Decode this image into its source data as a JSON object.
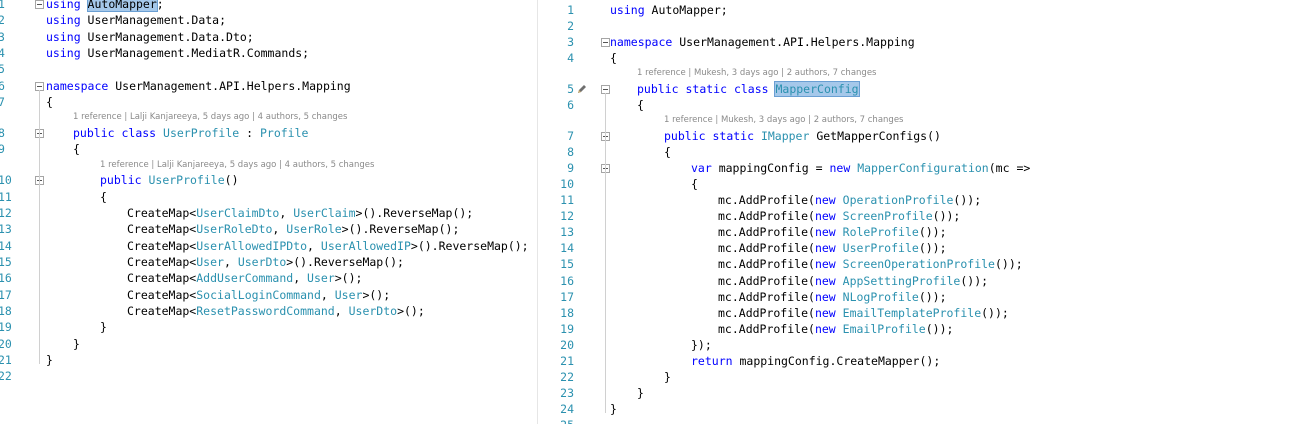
{
  "left": {
    "lines": [
      {
        "n": "1",
        "tokens": [
          {
            "t": "using ",
            "c": "kw"
          },
          {
            "t": "AutoMapper",
            "c": "hl"
          },
          {
            "t": ";",
            "c": ""
          }
        ],
        "indent": 0
      },
      {
        "n": "2",
        "tokens": [
          {
            "t": "using ",
            "c": "kw"
          },
          {
            "t": "UserManagement.Data;",
            "c": ""
          }
        ],
        "indent": 0
      },
      {
        "n": "3",
        "tokens": [
          {
            "t": "using ",
            "c": "kw"
          },
          {
            "t": "UserManagement.Data.Dto;",
            "c": ""
          }
        ],
        "indent": 0
      },
      {
        "n": "4",
        "tokens": [
          {
            "t": "using ",
            "c": "kw"
          },
          {
            "t": "UserManagement.MediatR.Commands;",
            "c": ""
          }
        ],
        "indent": 0
      },
      {
        "n": "5",
        "tokens": [],
        "indent": 0
      },
      {
        "n": "6",
        "tokens": [
          {
            "t": "namespace ",
            "c": "kw"
          },
          {
            "t": "UserManagement.API.Helpers.Mapping",
            "c": ""
          }
        ],
        "indent": 0
      },
      {
        "n": "7",
        "tokens": [
          {
            "t": "{",
            "c": ""
          }
        ],
        "indent": 0
      },
      {
        "n": "8",
        "tokens": [
          {
            "t": "public ",
            "c": "kw"
          },
          {
            "t": "class ",
            "c": "kw"
          },
          {
            "t": "UserProfile",
            "c": "ty"
          },
          {
            "t": " : ",
            "c": ""
          },
          {
            "t": "Profile",
            "c": "ty"
          }
        ],
        "indent": 1,
        "lens": "1 reference | Lalji Kanjareeya, 5 days ago | 4 authors, 5 changes"
      },
      {
        "n": "9",
        "tokens": [
          {
            "t": "{",
            "c": ""
          }
        ],
        "indent": 1
      },
      {
        "n": "10",
        "tokens": [
          {
            "t": "public ",
            "c": "kw"
          },
          {
            "t": "UserProfile",
            "c": "ty"
          },
          {
            "t": "()",
            "c": ""
          }
        ],
        "indent": 2,
        "lens": "1 reference | Lalji Kanjareeya, 5 days ago | 4 authors, 5 changes"
      },
      {
        "n": "11",
        "tokens": [
          {
            "t": "{",
            "c": ""
          }
        ],
        "indent": 2
      },
      {
        "n": "12",
        "tokens": [
          {
            "t": "CreateMap<",
            "c": ""
          },
          {
            "t": "UserClaimDto",
            "c": "ty"
          },
          {
            "t": ", ",
            "c": ""
          },
          {
            "t": "UserClaim",
            "c": "ty"
          },
          {
            "t": ">().ReverseMap();",
            "c": ""
          }
        ],
        "indent": 3
      },
      {
        "n": "13",
        "tokens": [
          {
            "t": "CreateMap<",
            "c": ""
          },
          {
            "t": "UserRoleDto",
            "c": "ty"
          },
          {
            "t": ", ",
            "c": ""
          },
          {
            "t": "UserRole",
            "c": "ty"
          },
          {
            "t": ">().ReverseMap();",
            "c": ""
          }
        ],
        "indent": 3
      },
      {
        "n": "14",
        "tokens": [
          {
            "t": "CreateMap<",
            "c": ""
          },
          {
            "t": "UserAllowedIPDto",
            "c": "ty"
          },
          {
            "t": ", ",
            "c": ""
          },
          {
            "t": "UserAllowedIP",
            "c": "ty"
          },
          {
            "t": ">().ReverseMap();",
            "c": ""
          }
        ],
        "indent": 3
      },
      {
        "n": "15",
        "tokens": [
          {
            "t": "CreateMap<",
            "c": ""
          },
          {
            "t": "User",
            "c": "ty"
          },
          {
            "t": ", ",
            "c": ""
          },
          {
            "t": "UserDto",
            "c": "ty"
          },
          {
            "t": ">().ReverseMap();",
            "c": ""
          }
        ],
        "indent": 3
      },
      {
        "n": "16",
        "tokens": [
          {
            "t": "CreateMap<",
            "c": ""
          },
          {
            "t": "AddUserCommand",
            "c": "ty"
          },
          {
            "t": ", ",
            "c": ""
          },
          {
            "t": "User",
            "c": "ty"
          },
          {
            "t": ">();",
            "c": ""
          }
        ],
        "indent": 3
      },
      {
        "n": "17",
        "tokens": [
          {
            "t": "CreateMap<",
            "c": ""
          },
          {
            "t": "SocialLoginCommand",
            "c": "ty"
          },
          {
            "t": ", ",
            "c": ""
          },
          {
            "t": "User",
            "c": "ty"
          },
          {
            "t": ">();",
            "c": ""
          }
        ],
        "indent": 3
      },
      {
        "n": "18",
        "tokens": [
          {
            "t": "CreateMap<",
            "c": ""
          },
          {
            "t": "ResetPasswordCommand",
            "c": "ty"
          },
          {
            "t": ", ",
            "c": ""
          },
          {
            "t": "UserDto",
            "c": "ty"
          },
          {
            "t": ">();",
            "c": ""
          }
        ],
        "indent": 3
      },
      {
        "n": "19",
        "tokens": [
          {
            "t": "}",
            "c": ""
          }
        ],
        "indent": 2
      },
      {
        "n": "20",
        "tokens": [
          {
            "t": "}",
            "c": ""
          }
        ],
        "indent": 1
      },
      {
        "n": "21",
        "tokens": [
          {
            "t": "}",
            "c": ""
          }
        ],
        "indent": 0
      },
      {
        "n": "22",
        "tokens": [],
        "indent": 0
      }
    ]
  },
  "right": {
    "lines": [
      {
        "n": "1",
        "tokens": [
          {
            "t": "using ",
            "c": "kw"
          },
          {
            "t": "AutoMapper;",
            "c": ""
          }
        ],
        "indent": 0
      },
      {
        "n": "2",
        "tokens": [],
        "indent": 0
      },
      {
        "n": "3",
        "tokens": [
          {
            "t": "namespace ",
            "c": "kw"
          },
          {
            "t": "UserManagement.API.Helpers.Mapping",
            "c": ""
          }
        ],
        "indent": 0
      },
      {
        "n": "4",
        "tokens": [
          {
            "t": "{",
            "c": ""
          }
        ],
        "indent": 0
      },
      {
        "n": "5",
        "tokens": [
          {
            "t": "public ",
            "c": "kw"
          },
          {
            "t": "static ",
            "c": "kw"
          },
          {
            "t": "class ",
            "c": "kw"
          },
          {
            "t": "MapperConfig",
            "c": "ty hl"
          }
        ],
        "indent": 1,
        "lens": "1 reference | Mukesh, 3 days ago | 2 authors, 7 changes"
      },
      {
        "n": "6",
        "tokens": [
          {
            "t": "{",
            "c": ""
          }
        ],
        "indent": 1
      },
      {
        "n": "7",
        "tokens": [
          {
            "t": "public ",
            "c": "kw"
          },
          {
            "t": "static ",
            "c": "kw"
          },
          {
            "t": "IMapper",
            "c": "ty"
          },
          {
            "t": " GetMapperConfigs()",
            "c": ""
          }
        ],
        "indent": 2,
        "lens": "1 reference | Mukesh, 3 days ago | 2 authors, 7 changes"
      },
      {
        "n": "8",
        "tokens": [
          {
            "t": "{",
            "c": ""
          }
        ],
        "indent": 2
      },
      {
        "n": "9",
        "tokens": [
          {
            "t": "var ",
            "c": "kw"
          },
          {
            "t": "mappingConfig = ",
            "c": ""
          },
          {
            "t": "new ",
            "c": "kw"
          },
          {
            "t": "MapperConfiguration",
            "c": "ty"
          },
          {
            "t": "(mc =>",
            "c": ""
          }
        ],
        "indent": 3
      },
      {
        "n": "10",
        "tokens": [
          {
            "t": "{",
            "c": ""
          }
        ],
        "indent": 3
      },
      {
        "n": "11",
        "tokens": [
          {
            "t": "mc.AddProfile(",
            "c": ""
          },
          {
            "t": "new ",
            "c": "kw"
          },
          {
            "t": "OperationProfile",
            "c": "ty"
          },
          {
            "t": "());",
            "c": ""
          }
        ],
        "indent": 4
      },
      {
        "n": "12",
        "tokens": [
          {
            "t": "mc.AddProfile(",
            "c": ""
          },
          {
            "t": "new ",
            "c": "kw"
          },
          {
            "t": "ScreenProfile",
            "c": "ty"
          },
          {
            "t": "());",
            "c": ""
          }
        ],
        "indent": 4
      },
      {
        "n": "13",
        "tokens": [
          {
            "t": "mc.AddProfile(",
            "c": ""
          },
          {
            "t": "new ",
            "c": "kw"
          },
          {
            "t": "RoleProfile",
            "c": "ty"
          },
          {
            "t": "());",
            "c": ""
          }
        ],
        "indent": 4
      },
      {
        "n": "14",
        "tokens": [
          {
            "t": "mc.AddProfile(",
            "c": ""
          },
          {
            "t": "new ",
            "c": "kw"
          },
          {
            "t": "UserProfile",
            "c": "ty"
          },
          {
            "t": "());",
            "c": ""
          }
        ],
        "indent": 4
      },
      {
        "n": "15",
        "tokens": [
          {
            "t": "mc.AddProfile(",
            "c": ""
          },
          {
            "t": "new ",
            "c": "kw"
          },
          {
            "t": "ScreenOperationProfile",
            "c": "ty"
          },
          {
            "t": "());",
            "c": ""
          }
        ],
        "indent": 4
      },
      {
        "n": "16",
        "tokens": [
          {
            "t": "mc.AddProfile(",
            "c": ""
          },
          {
            "t": "new ",
            "c": "kw"
          },
          {
            "t": "AppSettingProfile",
            "c": "ty"
          },
          {
            "t": "());",
            "c": ""
          }
        ],
        "indent": 4
      },
      {
        "n": "17",
        "tokens": [
          {
            "t": "mc.AddProfile(",
            "c": ""
          },
          {
            "t": "new ",
            "c": "kw"
          },
          {
            "t": "NLogProfile",
            "c": "ty"
          },
          {
            "t": "());",
            "c": ""
          }
        ],
        "indent": 4
      },
      {
        "n": "18",
        "tokens": [
          {
            "t": "mc.AddProfile(",
            "c": ""
          },
          {
            "t": "new ",
            "c": "kw"
          },
          {
            "t": "EmailTemplateProfile",
            "c": "ty"
          },
          {
            "t": "());",
            "c": ""
          }
        ],
        "indent": 4
      },
      {
        "n": "19",
        "tokens": [
          {
            "t": "mc.AddProfile(",
            "c": ""
          },
          {
            "t": "new ",
            "c": "kw"
          },
          {
            "t": "EmailProfile",
            "c": "ty"
          },
          {
            "t": "());",
            "c": ""
          }
        ],
        "indent": 4
      },
      {
        "n": "20",
        "tokens": [
          {
            "t": "});",
            "c": ""
          }
        ],
        "indent": 3
      },
      {
        "n": "21",
        "tokens": [
          {
            "t": "return ",
            "c": "kw"
          },
          {
            "t": "mappingConfig.CreateMapper();",
            "c": ""
          }
        ],
        "indent": 3
      },
      {
        "n": "22",
        "tokens": [
          {
            "t": "}",
            "c": ""
          }
        ],
        "indent": 2
      },
      {
        "n": "23",
        "tokens": [
          {
            "t": "}",
            "c": ""
          }
        ],
        "indent": 1
      },
      {
        "n": "24",
        "tokens": [
          {
            "t": "}",
            "c": ""
          }
        ],
        "indent": 0
      },
      {
        "n": "25",
        "tokens": [],
        "indent": 0
      }
    ]
  },
  "colors": {
    "keyword": "#0000ff",
    "type": "#2b91af",
    "line_number": "#2b91af",
    "highlight": "#a5c8ea",
    "codelens": "#8a8a8a"
  },
  "icons": {
    "edit_marker": "pencil-icon",
    "fold": "collapse-icon"
  }
}
